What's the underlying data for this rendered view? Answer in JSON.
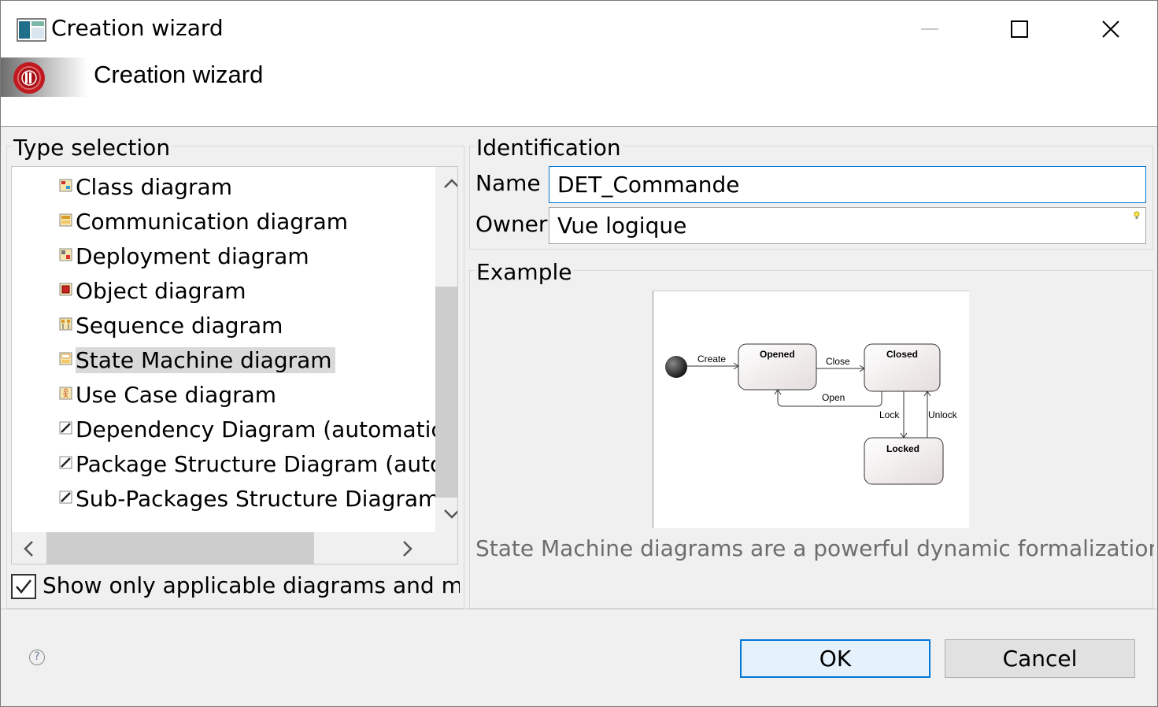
{
  "window": {
    "title": "Creation wizard"
  },
  "banner": {
    "title": "Creation wizard"
  },
  "type_selection": {
    "label": "Type selection",
    "items": [
      {
        "label": "Class diagram",
        "icon": "class-diagram-icon"
      },
      {
        "label": "Communication diagram",
        "icon": "communication-diagram-icon"
      },
      {
        "label": "Deployment diagram",
        "icon": "deployment-diagram-icon"
      },
      {
        "label": "Object diagram",
        "icon": "object-diagram-icon"
      },
      {
        "label": "Sequence diagram",
        "icon": "sequence-diagram-icon"
      },
      {
        "label": "State Machine diagram",
        "icon": "state-machine-diagram-icon",
        "selected": true
      },
      {
        "label": "Use Case diagram",
        "icon": "use-case-diagram-icon"
      },
      {
        "label": "Dependency Diagram (automatic)",
        "icon": "auto-diagram-icon"
      },
      {
        "label": "Package Structure Diagram (autor",
        "icon": "auto-diagram-icon"
      },
      {
        "label": "Sub-Packages Structure Diagram (",
        "icon": "auto-diagram-icon"
      }
    ],
    "show_only_label": "Show only applicable diagrams and mat",
    "show_only_checked": true
  },
  "identification": {
    "label": "Identification",
    "name_label": "Name",
    "name_value": "DET_Commande",
    "owner_label": "Owner",
    "owner_value": "Vue logique"
  },
  "example": {
    "label": "Example",
    "diagram": {
      "states": [
        "Opened",
        "Closed",
        "Locked"
      ],
      "transitions": [
        "Create",
        "Close",
        "Open",
        "Lock",
        "Unlock"
      ]
    },
    "description": "State Machine diagrams are a powerful dynamic formalization"
  },
  "buttons": {
    "ok": "OK",
    "cancel": "Cancel"
  },
  "colors": {
    "accent": "#0078d7",
    "selection": "#d9d9d9",
    "description_text": "#6d6d6d"
  }
}
